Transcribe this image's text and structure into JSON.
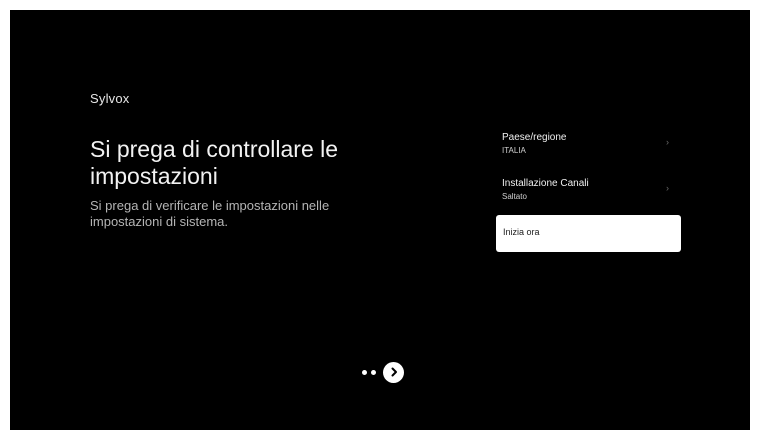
{
  "brand": "Sylvox",
  "title": "Si prega di controllare le impostazioni",
  "subtitle": "Si prega di verificare le impostazioni nelle impostazioni di sistema.",
  "settings": [
    {
      "label": "Paese/regione",
      "value": "ITALIA",
      "icon": "chevron-right-icon"
    },
    {
      "label": "Installazione Canali",
      "value": "Saltato",
      "icon": "chevron-right-icon"
    }
  ],
  "start_button": {
    "label": "Inizia ora"
  },
  "pager": {
    "dots": 2,
    "next_icon": "chevron-right-circle-icon"
  },
  "colors": {
    "background": "#000000",
    "text": "#ffffff",
    "secondary_text": "#b4b4b4",
    "focus": "#ffffff"
  }
}
